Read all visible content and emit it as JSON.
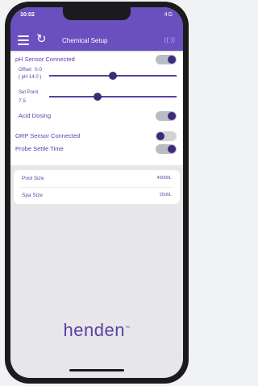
{
  "status_bar": {
    "time": "10:02",
    "signal": "4G",
    "signal_icons": "signal-wifi-battery-icons"
  },
  "app_bar": {
    "title": "Chemical Setup",
    "menu_icon": "hamburger-icon",
    "refresh_icon": "refresh-icon",
    "connection_icon": "wireless-icon",
    "connection_glyph": "((·))"
  },
  "ph": {
    "sensor_label": "pH Sensor Connected",
    "sensor_on": true,
    "offset_label": "Offset",
    "offset_value": "0.0",
    "offset_note": "( pH 14.0 )",
    "offset_slider": 0.5,
    "setpoint_label": "Set Point",
    "setpoint_value": "7.5",
    "setpoint_slider": 0.38,
    "acid_label": "Acid Dosing",
    "acid_on": true
  },
  "orp": {
    "sensor_label": "ORP Sensor Connected",
    "sensor_on": false
  },
  "probe": {
    "label": "Probe Settle Time",
    "on": true
  },
  "sizes": [
    {
      "label": "Pool Size",
      "value": "45000L"
    },
    {
      "label": "Spa Size",
      "value": "2500L"
    }
  ],
  "brand": {
    "name": "henden",
    "mark": "™"
  },
  "colors": {
    "accent": "#6a4fbe",
    "text": "#5b3fa8",
    "knob": "#3d2b7a"
  }
}
